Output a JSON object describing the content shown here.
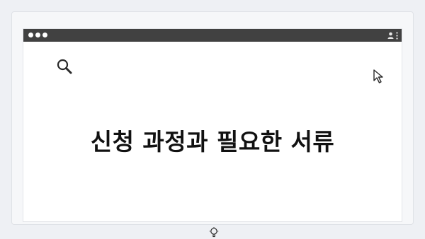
{
  "page": {
    "heading": "신청 과정과 필요한 서류"
  },
  "icons": {
    "search": "search-icon",
    "cursor": "cursor-arrow-icon",
    "lightbulb": "lightbulb-icon",
    "user": "user-icon",
    "menu": "more-vertical-icon"
  },
  "colors": {
    "titlebar": "#414141",
    "background": "#eef0f4",
    "heading": "#111111"
  }
}
